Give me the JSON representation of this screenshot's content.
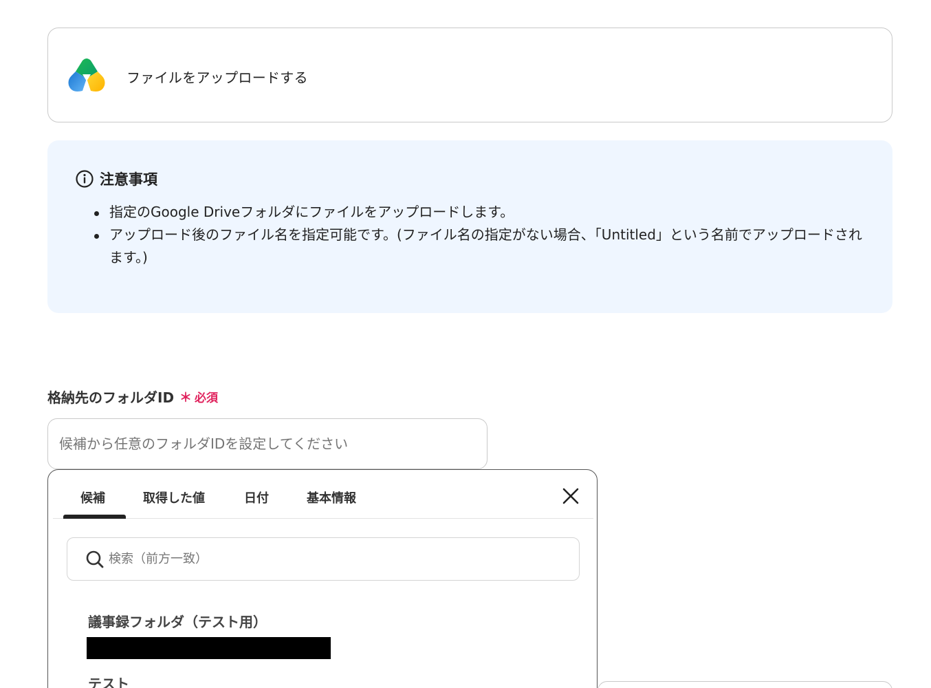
{
  "app": {
    "title": "ファイルをアップロードする",
    "logo_icon": "yoom-logo-icon"
  },
  "notice": {
    "title": "注意事項",
    "items": [
      "指定のGoogle Driveフォルダにファイルをアップロードします。",
      "アップロード後のファイル名を指定可能です。(ファイル名の指定がない場合、「Untitled」という名前でアップロードされます。)"
    ]
  },
  "field": {
    "label": "格納先のフォルダID",
    "required_mark": "＊",
    "required_text": "必須",
    "placeholder": "候補から任意のフォルダIDを設定してください"
  },
  "picker": {
    "tabs": [
      "候補",
      "取得した値",
      "日付",
      "基本情報"
    ],
    "active_tab": "候補",
    "search_placeholder": "検索（前方一致）",
    "options": [
      {
        "title": "議事録フォルダ（テスト用）"
      },
      {
        "title": "テスト"
      }
    ]
  },
  "colors": {
    "notice_bg": "#eff6ff",
    "required": "#e0245e",
    "border": "#c9c9c9"
  }
}
